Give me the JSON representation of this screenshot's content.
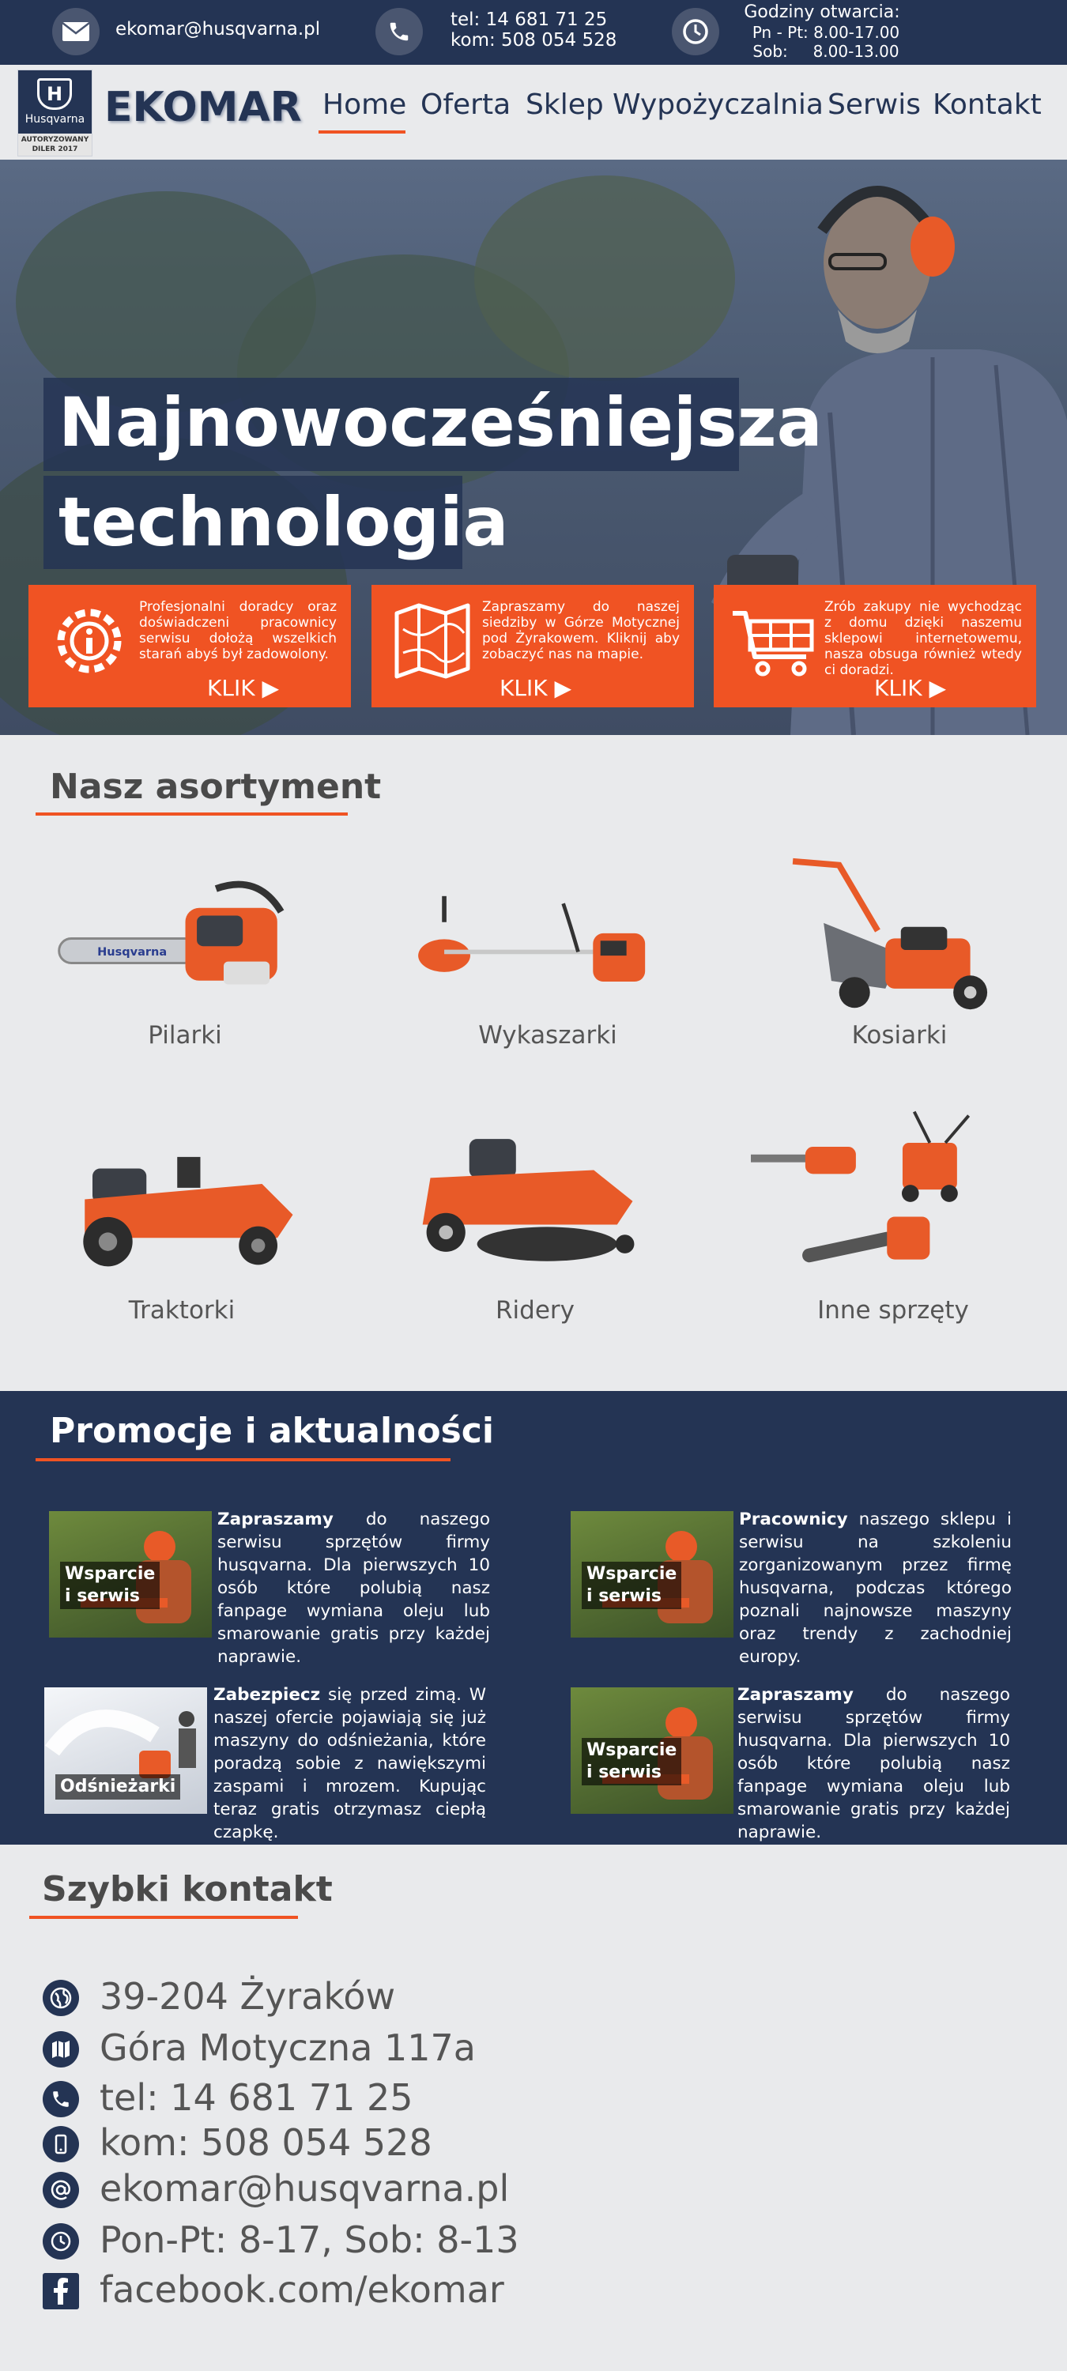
{
  "topbar": {
    "email": "ekomar@husqvarna.pl",
    "phone_line1": "tel: 14 681 71 25",
    "phone_line2": "kom: 508 054 528",
    "hours_title": "Godziny otwarcia:",
    "hours_weekday": "Pn - Pt: 8.00-17.00",
    "hours_saturday": "Sob:     8.00-13.00",
    "icons": [
      "envelope-icon",
      "phone-icon",
      "clock-icon"
    ]
  },
  "logo": {
    "word": "Husqvarna",
    "badge_line1": "AUTORYZOWANY",
    "badge_line2": "DILER 2017"
  },
  "brand": "EKOMAR",
  "nav": {
    "items": [
      "Home",
      "Oferta",
      "Sklep",
      "Wypożyczalnia",
      "Serwis",
      "Kontakt"
    ],
    "active": "Home"
  },
  "hero": {
    "title_line1": "Najnowocześniejsza",
    "title_line2": "technologia",
    "cards": [
      {
        "icon": "service-gear-icon",
        "text": "Profesjonalni doradcy oraz doświadczeni pracownicy serwisu dołożą wszelkich starań abyś był zadowolony.",
        "klik": "KLIK ▶"
      },
      {
        "icon": "map-icon",
        "text": "Zapraszamy do naszej siedziby w Górze Motycznej pod Żyrakowem. Kliknij aby zobaczyć nas na mapie.",
        "klik": "KLIK ▶"
      },
      {
        "icon": "shopping-cart-icon",
        "text": "Zrób zakupy nie wychodząc z domu dzięki naszemu sklepowi internetowemu, nasza obsuga również wtedy ci doradzi.",
        "klik": "KLIK ▶"
      }
    ]
  },
  "assortment": {
    "title": "Nasz asortyment",
    "items": [
      "Pilarki",
      "Wykaszarki",
      "Kosiarki",
      "Traktorki",
      "Ridery",
      "Inne sprzęty"
    ]
  },
  "promo": {
    "title": "Promocje i aktualności",
    "items": [
      {
        "thumb_line1": "Wsparcie",
        "thumb_line2": "i serwis",
        "bold": "Zapraszamy",
        "text": " do naszego serwisu sprzętów firmy husqvarna. Dla pierwszych 10 osób które polubią nasz fanpage wymiana oleju lub smarowanie gratis przy każdej naprawie."
      },
      {
        "thumb_line1": "Wsparcie",
        "thumb_line2": "i serwis",
        "bold": "Pracownicy",
        "text": " naszego sklepu i serwisu na szkoleniu zorganizowanym przez firmę husqvarna, podczas którego poznali najnowsze maszyny oraz trendy z zachodniej europy."
      },
      {
        "thumb_line1": "Odśnieżarki",
        "thumb_line2": "",
        "bold": "Zabezpiecz",
        "text": " się przed zimą. W naszej ofercie pojawiają się już maszyny do odśnieżania, które poradzą sobie z nawiększymi zaspami i mrozem. Kupując teraz gratis otrzymasz ciepłą czapkę."
      },
      {
        "thumb_line1": "Wsparcie",
        "thumb_line2": "i serwis",
        "bold": "Zapraszamy",
        "text": " do naszego serwisu sprzętów firmy husqvarna. Dla pierwszych 10 osób które polubią nasz fanpage wymiana oleju lub smarowanie gratis przy każdej naprawie."
      }
    ]
  },
  "contact": {
    "title": "Szybki kontakt",
    "rows": [
      {
        "icon": "globe-icon",
        "text": "39-204 Żyraków"
      },
      {
        "icon": "map-icon",
        "text": "Góra Motyczna 117a"
      },
      {
        "icon": "phone-icon",
        "text": "tel: 14 681 71 25"
      },
      {
        "icon": "mobile-icon",
        "text": "kom: 508 054 528"
      },
      {
        "icon": "at-icon",
        "text": "ekomar@husqvarna.pl"
      },
      {
        "icon": "clock-icon",
        "text": "Pon-Pt: 8-17, Sob: 8-13"
      },
      {
        "icon": "facebook-icon",
        "text": "facebook.com/ekomar"
      }
    ]
  },
  "colors": {
    "navy": "#243454",
    "orange": "#f05323",
    "background": "#e9eaec"
  }
}
